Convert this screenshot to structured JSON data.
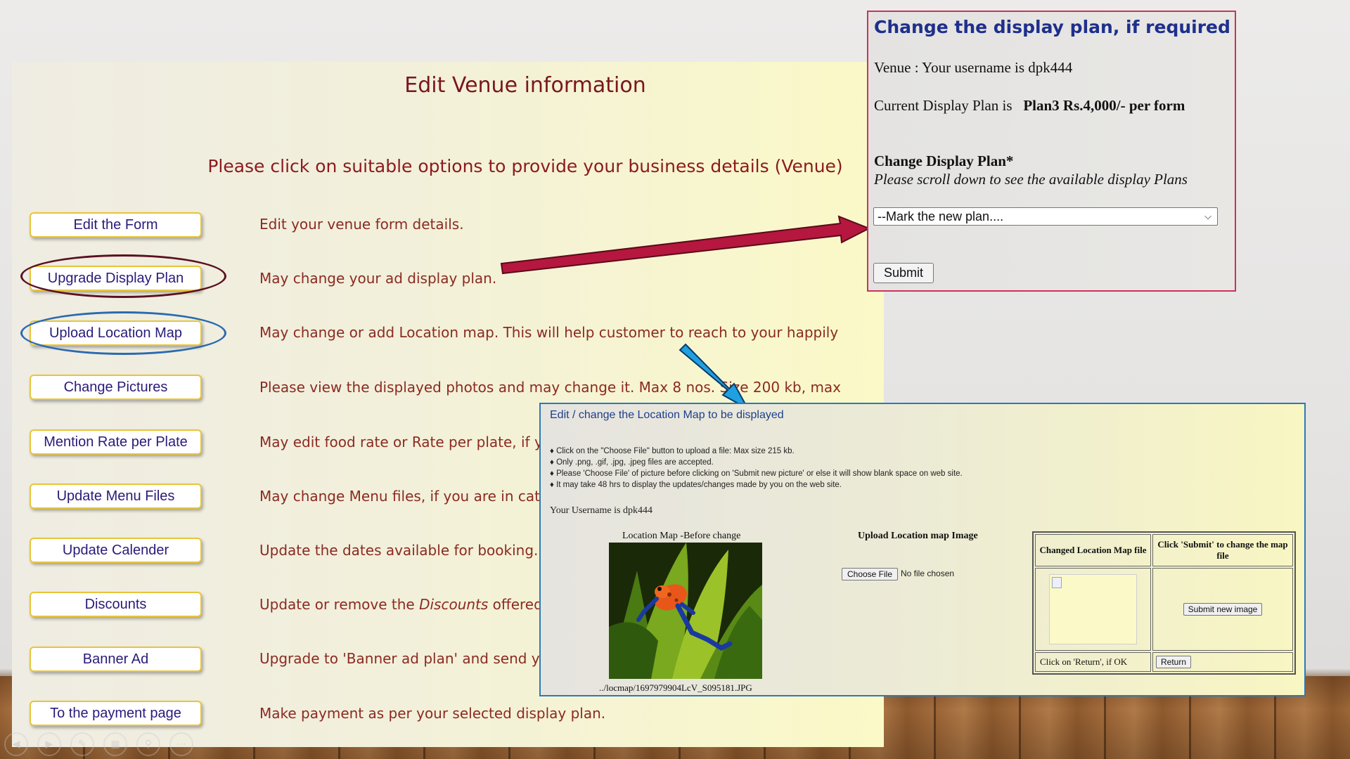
{
  "main": {
    "title": "Edit Venue information",
    "subtitle": "Please click on suitable options to provide your business details (Venue)",
    "options": [
      {
        "label": "Edit the Form",
        "desc": "Edit your venue form details."
      },
      {
        "label": "Upgrade Display Plan",
        "desc": "May change your ad display plan."
      },
      {
        "label": "Upload Location Map",
        "desc": "May change or add Location map. This will help customer to reach to your happily"
      },
      {
        "label": "Change Pictures",
        "desc": "Please view the displayed photos and may change it. Max 8 nos. Size 200 kb, max"
      },
      {
        "label": "Mention Rate per Plate",
        "desc": "May edit food rate or Rate per plate, if yo"
      },
      {
        "label": "Update Menu Files",
        "desc": "May change Menu files, if you are in cater"
      },
      {
        "label": "Update Calender",
        "desc": "Update the dates available for booking. H"
      },
      {
        "label": "Discounts",
        "desc_pre": "Update or remove the ",
        "desc_em": "Discounts",
        "desc_post": " offered t"
      },
      {
        "label": "Banner Ad",
        "desc": "Upgrade to 'Banner ad plan' and send you"
      },
      {
        "label": "To the payment page",
        "desc": "Make payment as per your selected display plan."
      }
    ]
  },
  "plan_box": {
    "title": "Change the display plan, if required",
    "venue_line": "Venue : Your username is dpk444",
    "current_label": "Current Display Plan is",
    "current_value": "Plan3 Rs.4,000/- per form",
    "change_label": "Change Display Plan*",
    "scroll_hint": "Please scroll down to see the available display Plans",
    "select_value": "--Mark the new plan....",
    "submit_label": "Submit"
  },
  "map_box": {
    "title": "Edit / change the Location Map to be displayed",
    "bullets": [
      "♦ Click on the \"Choose File\" button to upload a file: Max size 215 kb.",
      "♦ Only .png, .gif, .jpg, .jpeg files are accepted.",
      "♦ Please 'Choose File' of picture before clicking on 'Submit new picture' or else it will show blank space on web site.",
      "♦ It may take 48 hrs to display the updates/changes made by you on the web site."
    ],
    "username": "Your Username is dpk444",
    "before_caption": "Location Map -Before change",
    "file_path": "../locmap/1697979904LcV_S095181.JPG",
    "upload_heading": "Upload Location map Image",
    "choose_label": "Choose File",
    "no_file": "No file chosen",
    "table": {
      "col1_header": "Changed Location Map file",
      "col2_header": "Click 'Submit' to change the map file",
      "submit_image_label": "Submit new image",
      "return_text": "Click on 'Return', if OK",
      "return_label": "Return"
    }
  },
  "colors": {
    "title_red": "#7a1620",
    "button_border": "#e8c53a",
    "plan_border": "#c9345a",
    "map_border": "#2a7ab8",
    "arrow_red": "#b5173f",
    "arrow_blue": "#1fa0e0"
  }
}
